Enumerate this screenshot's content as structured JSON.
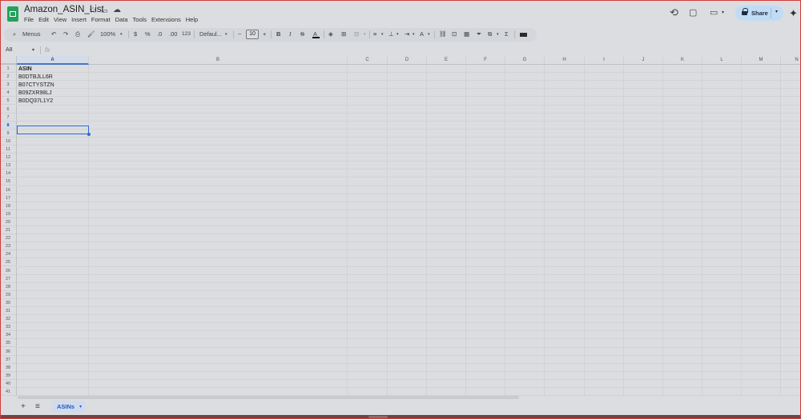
{
  "header": {
    "title": "Amazon_ASIN_List",
    "menus": [
      "File",
      "Edit",
      "View",
      "Insert",
      "Format",
      "Data",
      "Tools",
      "Extensions",
      "Help"
    ],
    "share_label": "Share"
  },
  "toolbar": {
    "search_label": "Menus",
    "zoom": "100%",
    "currency": "$",
    "percent": "%",
    "dec_decrease": ".0",
    "dec_increase": ".00",
    "format_123": "123",
    "font": "Defaul...",
    "font_size": "10",
    "bold": "B",
    "italic": "I",
    "strike": "S",
    "text_color": "A",
    "sum": "Σ",
    "minus": "−",
    "plus": "+"
  },
  "formula_bar": {
    "name_box": "A8",
    "fx": "fx"
  },
  "columns": [
    "A",
    "B",
    "C",
    "D",
    "E",
    "F",
    "G",
    "H",
    "I",
    "J",
    "K",
    "L",
    "M",
    "N"
  ],
  "rows": [
    "1",
    "2",
    "3",
    "4",
    "5",
    "6",
    "7",
    "8",
    "9",
    "10",
    "11",
    "12",
    "13",
    "14",
    "15",
    "16",
    "17",
    "18",
    "19",
    "20",
    "21",
    "22",
    "23",
    "24",
    "25",
    "26",
    "27",
    "28",
    "29",
    "30",
    "31",
    "32",
    "33",
    "34",
    "35",
    "36",
    "37",
    "38",
    "39",
    "40",
    "41"
  ],
  "cells": {
    "A1": "ASIN",
    "A2": "B0DTBJLL6R",
    "A3": "B07CTYSTZN",
    "A4": "B09ZXR98LJ",
    "A5": "B0DQ37L1Y2"
  },
  "selected_cell": "A8",
  "sheets": [
    {
      "name": "ASINs",
      "active": true
    }
  ],
  "colors": {
    "accent": "#2b6ad8",
    "share_bg": "#c2dbf5",
    "sheets_green": "#22a25a"
  }
}
